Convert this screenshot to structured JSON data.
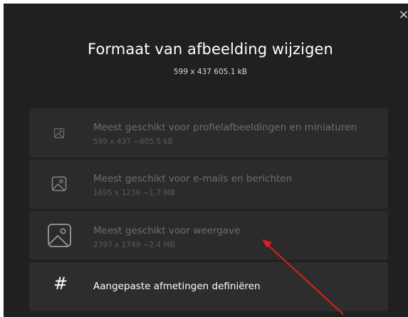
{
  "dialog": {
    "title": "Formaat van afbeelding wijzigen",
    "subtitle": "599 x 437   605.1 kB",
    "close_label": "×"
  },
  "options": [
    {
      "label": "Meest geschikt voor profielafbeeldingen en miniaturen",
      "dims": "599 x 437   ~605.5 kB",
      "icon": "image-icon-small"
    },
    {
      "label": "Meest geschikt voor e-mails en berichten",
      "dims": "1695 x 1236   ~1.7 MB",
      "icon": "image-icon-medium"
    },
    {
      "label": "Meest geschikt voor weergave",
      "dims": "2397 x 1749   ~2.4 MB",
      "icon": "image-icon-large"
    },
    {
      "label": "Aangepaste afmetingen definiëren",
      "icon": "hash-icon",
      "glyph": "#"
    }
  ],
  "colors": {
    "background": "#202020",
    "card": "#2b2b2b",
    "disabled_text": "#6e6e6e",
    "annotation_arrow": "#e01e1e"
  }
}
